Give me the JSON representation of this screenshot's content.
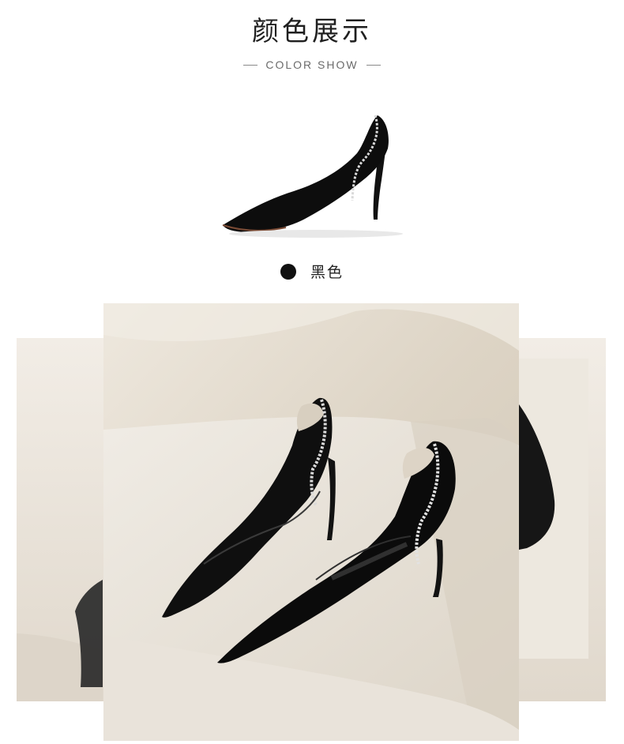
{
  "header": {
    "title": "颜色展示",
    "subtitle": "COLOR SHOW"
  },
  "product": {
    "icon": "black-pump-shoe-icon"
  },
  "swatch": {
    "label": "黑色",
    "color": "#111111"
  },
  "gallery": {
    "icons": [
      "shoe-pair-photo",
      "left-side-panel",
      "right-side-panel"
    ]
  }
}
